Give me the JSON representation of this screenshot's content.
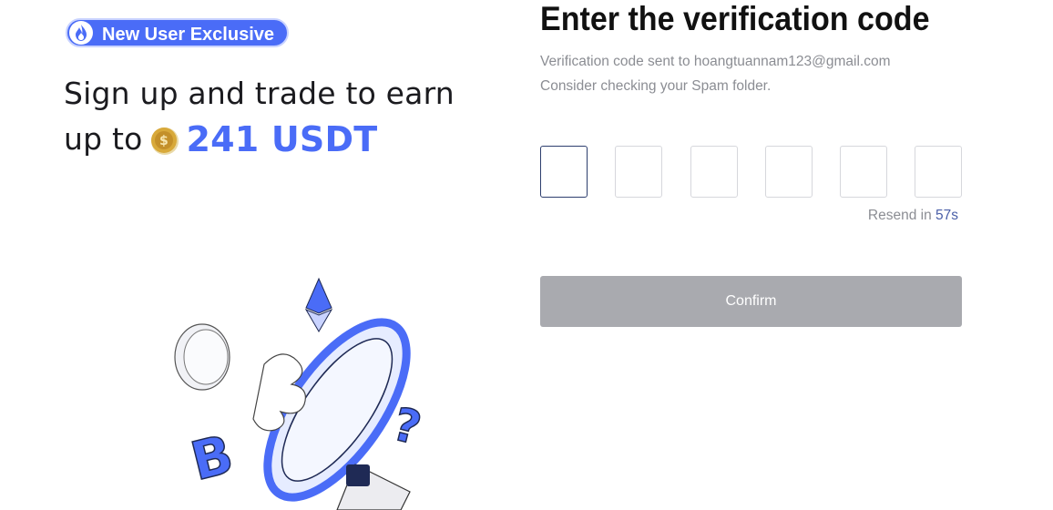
{
  "promo": {
    "badge": "New User Exclusive",
    "headline_line1": "Sign up and trade to earn",
    "headline_prefix": "up to",
    "amount": "241 USDT",
    "accent_color": "#4a6cf7"
  },
  "verify": {
    "title": "Enter the verification code",
    "sent_to": "Verification code sent to hoangtuannam123@gmail.com",
    "spam_hint": "Consider checking your Spam folder.",
    "code_digits": [
      "",
      "",
      "",
      "",
      "",
      ""
    ],
    "resend_prefix": "Resend in",
    "resend_countdown": "57s",
    "confirm_label": "Confirm",
    "confirm_color": "#a9aaaf"
  },
  "icons": [
    "flame-logo-icon",
    "gold-coin-icon",
    "megaphone-illustration",
    "bitcoin-icon",
    "ethereum-icon",
    "question-mark-icon",
    "silver-coin-icon"
  ]
}
